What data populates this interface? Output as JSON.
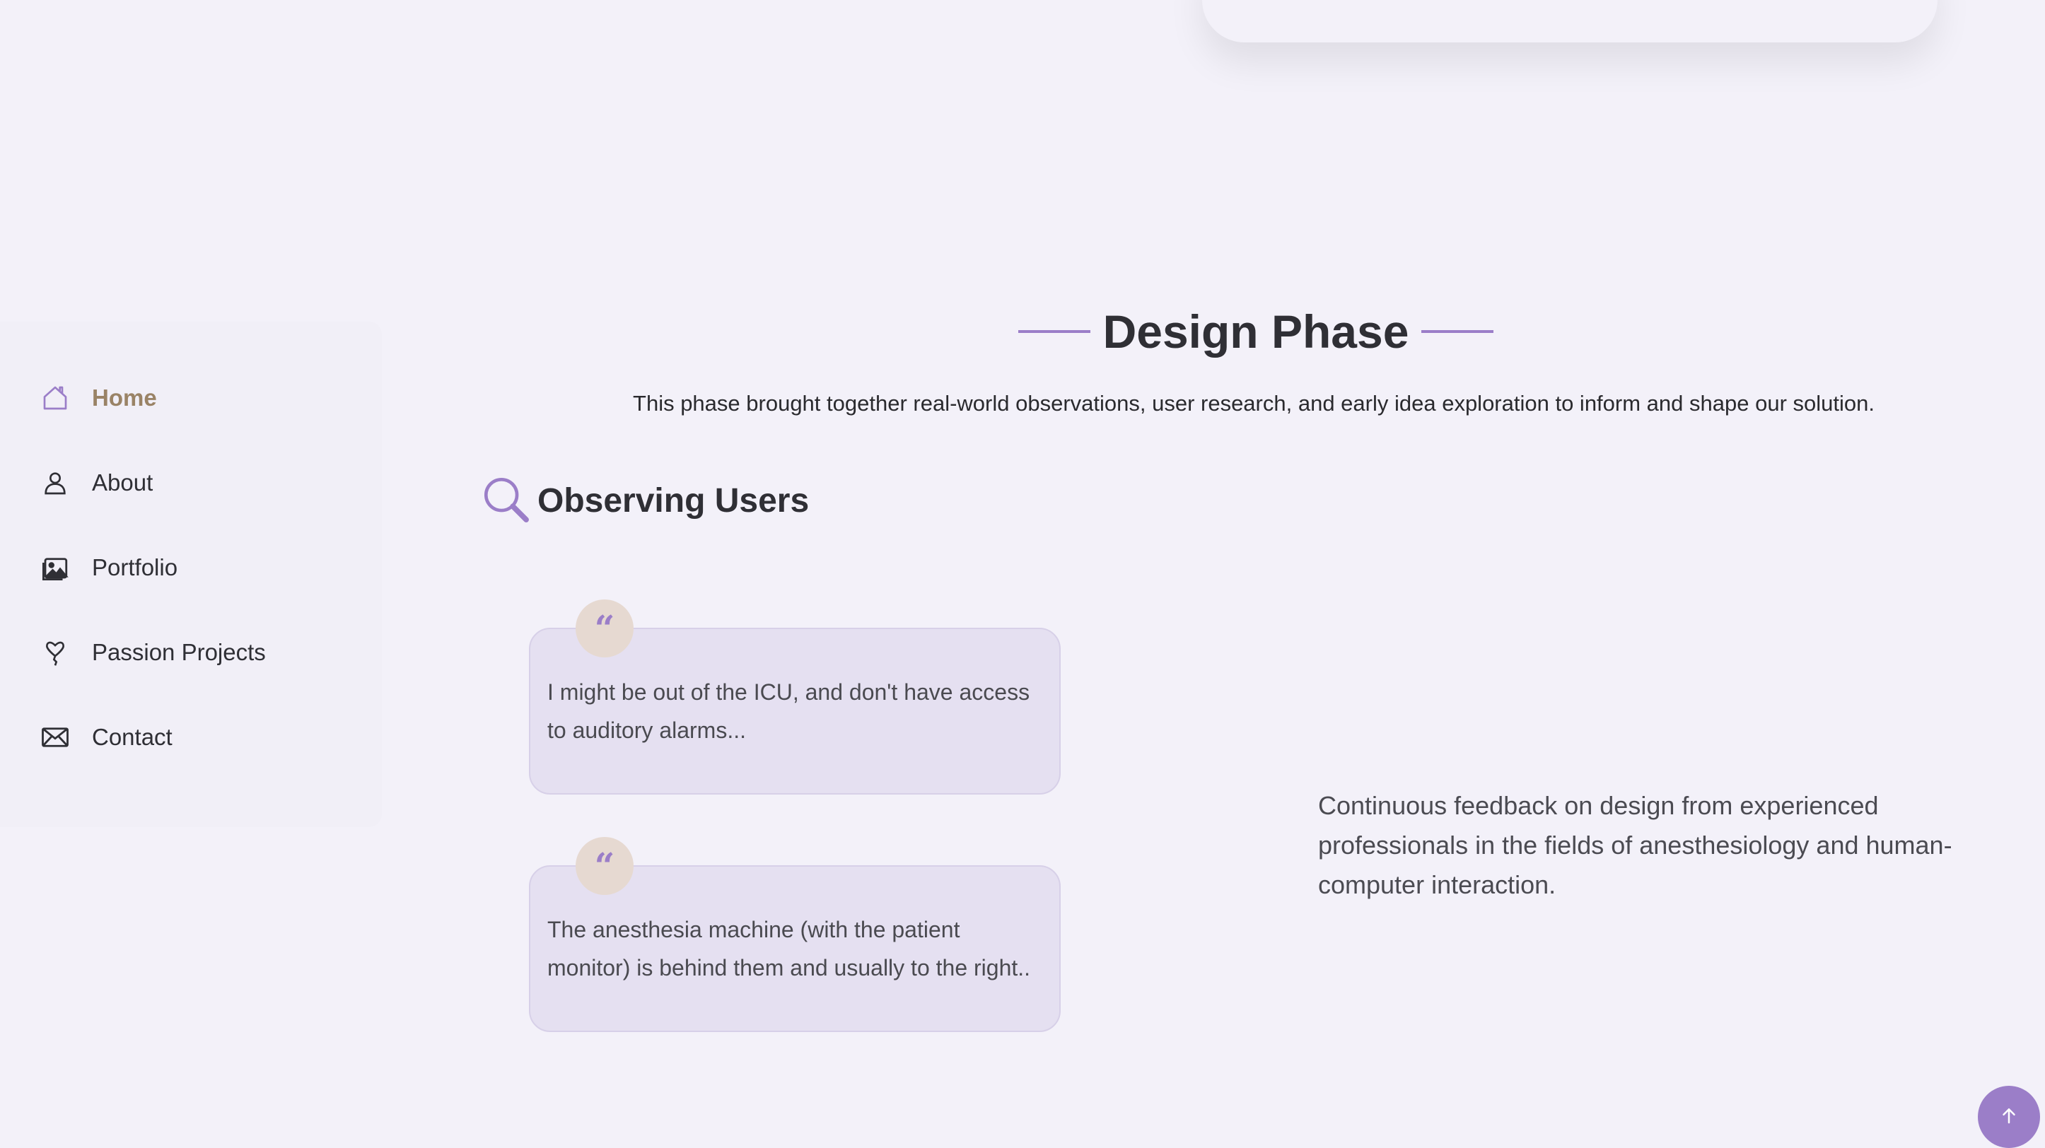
{
  "nav": {
    "items": [
      {
        "label": "Home",
        "icon": "home-icon",
        "active": true
      },
      {
        "label": "About",
        "icon": "user-icon",
        "active": false
      },
      {
        "label": "Portfolio",
        "icon": "image-icon",
        "active": false
      },
      {
        "label": "Passion Projects",
        "icon": "balloon-icon",
        "active": false
      },
      {
        "label": "Contact",
        "icon": "mail-icon",
        "active": false
      }
    ]
  },
  "section": {
    "title": "Design Phase",
    "intro": "This phase brought together real-world observations, user research, and early idea exploration to inform and shape our solution."
  },
  "observing": {
    "title": "Observing Users",
    "icon": "search-icon",
    "quotes": [
      {
        "mark": "“",
        "text": "I might be out of the ICU, and don't have access to auditory alarms..."
      },
      {
        "mark": "“",
        "text": "The anesthesia machine (with the patient monitor) is behind them and usually to the right.."
      }
    ]
  },
  "feedback": {
    "text": "Continuous feedback on design from experienced professionals in the fields of anesthesiology and human-computer interaction."
  },
  "colors": {
    "accent": "#9b7ec8",
    "active_nav": "#9a8366",
    "background": "#f3f1f9",
    "card": "#e5e0f1"
  }
}
